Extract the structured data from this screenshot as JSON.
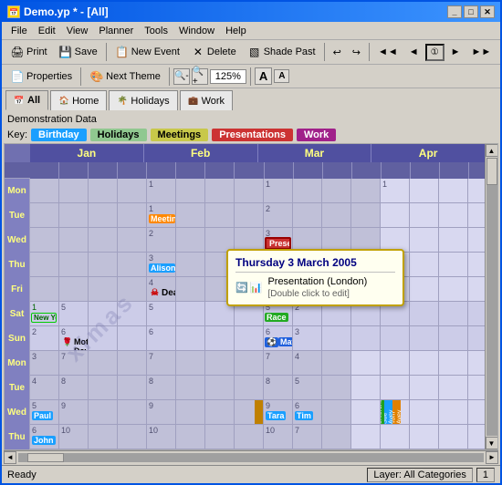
{
  "window": {
    "title": "Demo.yp * - [All]",
    "icon": "📅"
  },
  "menu": {
    "items": [
      "File",
      "Edit",
      "View",
      "Planner",
      "Tools",
      "Window",
      "Help"
    ]
  },
  "toolbar1": {
    "buttons": [
      "Print",
      "Save",
      "New Event",
      "Delete",
      "Shade Past"
    ],
    "nav_buttons": [
      "◄◄",
      "◄",
      "①",
      "►",
      "►◄",
      "◄►",
      "►►"
    ]
  },
  "toolbar2": {
    "next_theme_label": "Next Theme",
    "zoom_value": "125%",
    "font_size_buttons": [
      "A",
      "A"
    ]
  },
  "tabs": [
    {
      "label": "All",
      "active": true
    },
    {
      "label": "Home"
    },
    {
      "label": "Holidays"
    },
    {
      "label": "Work"
    }
  ],
  "demo_label": "Demonstration Data",
  "key": {
    "label": "Key:",
    "items": [
      {
        "label": "Birthday",
        "color": "#1a9fff"
      },
      {
        "label": "Holidays",
        "color": "#90c890"
      },
      {
        "label": "Meetings",
        "color": "#c8c84a"
      },
      {
        "label": "Presentations",
        "color": "#cc3333"
      },
      {
        "label": "Work",
        "color": "#a0208a"
      }
    ]
  },
  "months": [
    "Jan",
    "Feb",
    "Mar",
    "Apr"
  ],
  "day_names": [
    "Mon",
    "Tue",
    "Wed",
    "Thu",
    "Fri",
    "Sat",
    "Sun"
  ],
  "tooltip": {
    "title": "Thursday 3 March 2005",
    "event": "Presentation (London)",
    "hint": "[Double click to edit]"
  },
  "status": {
    "left": "Ready",
    "right": "Layer: All Categories",
    "panel": "1"
  },
  "watermark": "ximas",
  "events": {
    "newyears": "New Year's Day",
    "meeting": "Meeting",
    "alison": "Alison",
    "presentation": "Presentation",
    "deadline": "Deadline",
    "race": "Race",
    "mothersday": "Mothers Day",
    "match": "Match",
    "paul": "Paul",
    "john": "John",
    "tara": "Tara",
    "tim": "Tim",
    "conference": "Conference",
    "sue_avey": "Sue Avey",
    "tom_avey": "Tom Avey"
  }
}
